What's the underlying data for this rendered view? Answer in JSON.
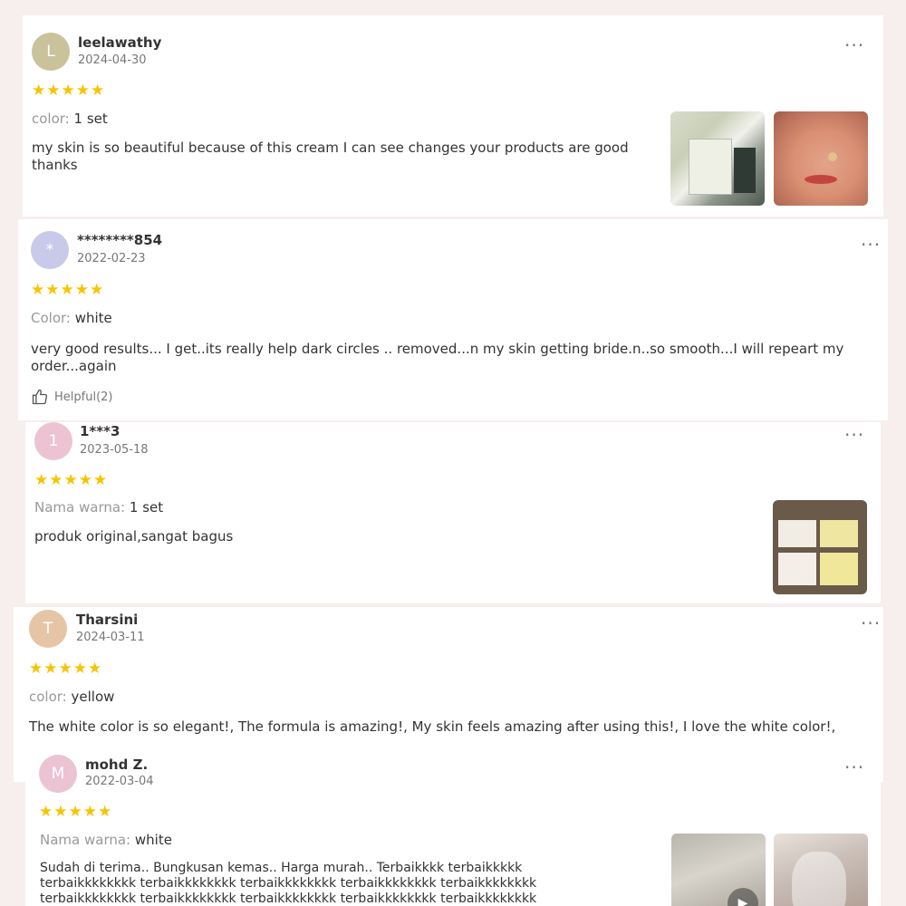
{
  "colors": {
    "page_bg": "#f6efee",
    "star": "#f7c400",
    "avatar_l": "#c9c29a",
    "avatar_star": "#c9c9ea",
    "avatar_1": "#ecc3d2",
    "avatar_t": "#e6c4a6",
    "avatar_m": "#ecc3d2"
  },
  "reviews": [
    {
      "initial": "L",
      "username": "leelawathy",
      "date": "2024-04-30",
      "rating": 5,
      "stars": "★★★★★",
      "variant_label": "color:",
      "variant_value": "1 set",
      "text": "my skin is so beautiful because of this cream I can see changes your products are good thanks",
      "more": "···",
      "photos": [
        "product-box-photo",
        "face-photo"
      ]
    },
    {
      "initial": "*",
      "username": "********854",
      "date": "2022-02-23",
      "rating": 5,
      "stars": "★★★★★",
      "variant_label": "Color:",
      "variant_value": "white",
      "text": "very good results... I get..its really help dark circles .. removed...n my skin getting bride.n..so smooth...I will repeart my order...again",
      "helpful": "Helpful(2)",
      "helpful_icon": "thumbs-up-icon",
      "more": "···"
    },
    {
      "initial": "1",
      "username": "1***3",
      "date": "2023-05-18",
      "rating": 5,
      "stars": "★★★★★",
      "variant_label": "Nama warna:",
      "variant_value": "1 set",
      "text": "produk original,sangat bagus",
      "more": "···",
      "photos": [
        "product-boxes-photo"
      ]
    },
    {
      "initial": "T",
      "username": "Tharsini",
      "date": "2024-03-11",
      "rating": 5,
      "stars": "★★★★★",
      "variant_label": "color:",
      "variant_value": "yellow",
      "text": "The white color is so elegant!, The formula is amazing!, My skin feels amazing after using this!, I love the white color!,",
      "more": "···"
    },
    {
      "initial": "M",
      "username": "mohd Z.",
      "date": "2022-03-04",
      "rating": 5,
      "stars": "★★★★★",
      "variant_label": "Nama warna:",
      "variant_value": "white",
      "text": "Sudah di terima.. Bungkusan kemas.. Harga murah.. Terbaikkkk terbaikkkkk terbaikkkkkkkk terbaikkkkkkkk terbaikkkkkkkk terbaikkkkkkkk terbaikkkkkkkk terbaikkkkkkkk terbaikkkkkkkk terbaikkkkkkkk terbaikkkkkkkk terbaikkkkkkkk",
      "more": "···",
      "photos": [
        "video-thumbnail",
        "package-photo"
      ]
    }
  ]
}
